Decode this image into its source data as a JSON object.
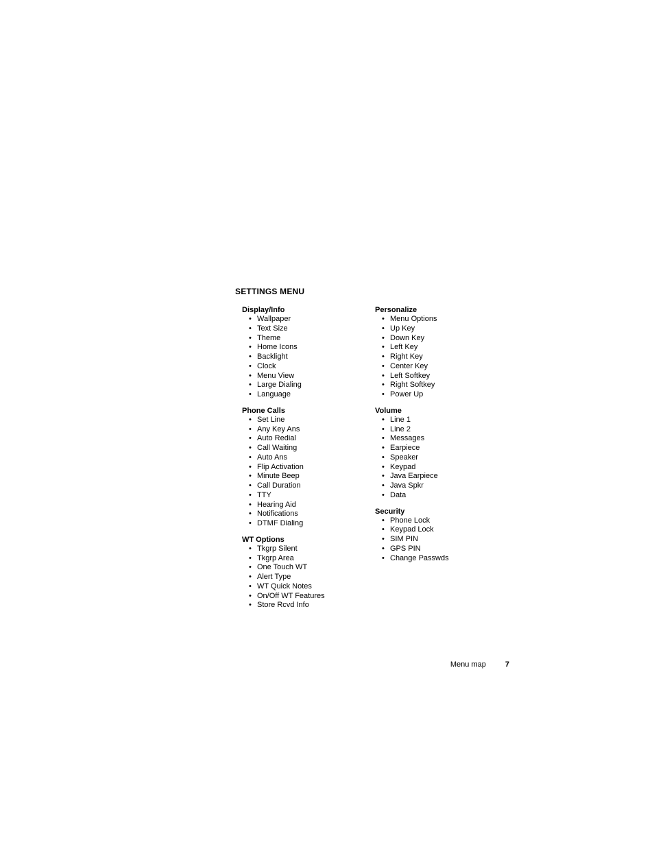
{
  "title": "SETTINGS MENU",
  "columnA": [
    {
      "heading": "Display/Info",
      "items": [
        "Wallpaper",
        "Text Size",
        "Theme",
        "Home Icons",
        "Backlight",
        "Clock",
        "Menu View",
        "Large Dialing",
        "Language"
      ]
    },
    {
      "heading": "Phone Calls",
      "items": [
        "Set Line",
        "Any Key Ans",
        "Auto Redial",
        "Call Waiting",
        "Auto Ans",
        "Flip Activation",
        "Minute Beep",
        "Call Duration",
        "TTY",
        "Hearing Aid",
        "Notifications",
        "DTMF Dialing"
      ]
    },
    {
      "heading": "WT Options",
      "items": [
        "Tkgrp Silent",
        "Tkgrp Area",
        "One Touch WT",
        "Alert Type",
        "WT Quick Notes",
        "On/Off WT Features",
        "Store Rcvd Info"
      ]
    }
  ],
  "columnB": [
    {
      "heading": "Personalize",
      "items": [
        "Menu Options",
        "Up Key",
        "Down Key",
        "Left Key",
        "Right Key",
        "Center Key",
        "Left Softkey",
        "Right Softkey",
        "Power Up"
      ]
    },
    {
      "heading": "Volume",
      "items": [
        "Line 1",
        "Line 2",
        "Messages",
        "Earpiece",
        "Speaker",
        "Keypad",
        "Java Earpiece",
        "Java Spkr",
        "Data"
      ]
    },
    {
      "heading": "Security",
      "items": [
        "Phone Lock",
        "Keypad Lock",
        "SIM PIN",
        "GPS PIN",
        "Change Passwds"
      ]
    }
  ],
  "footer": {
    "label": "Menu map",
    "page": "7"
  }
}
